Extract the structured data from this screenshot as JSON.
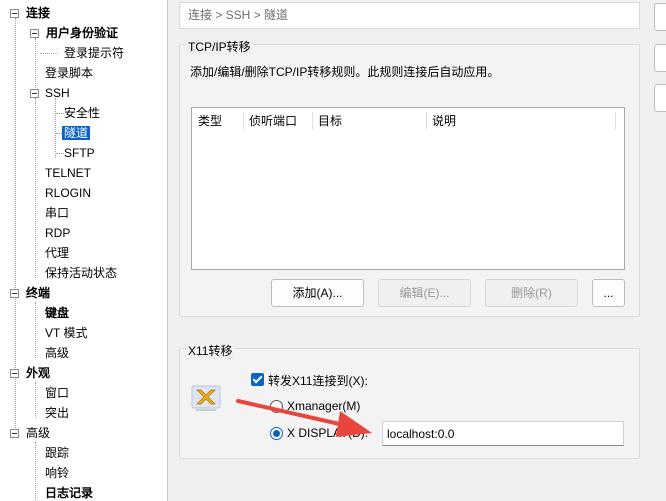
{
  "tree": {
    "connection": "连接",
    "user_auth": "用户身份验证",
    "login_prompt": "登录提示符",
    "login_script": "登录脚本",
    "ssh": "SSH",
    "security": "安全性",
    "tunnel": "隧道",
    "sftp": "SFTP",
    "telnet": "TELNET",
    "rlogin": "RLOGIN",
    "serial": "串口",
    "rdp": "RDP",
    "proxy": "代理",
    "keepalive": "保持活动状态",
    "terminal": "终端",
    "keyboard": "键盘",
    "vt_mode": "VT 模式",
    "terminal_advanced": "高级",
    "appearance": "外观",
    "window": "窗口",
    "highlight": "突出",
    "advanced": "高级",
    "trace": "跟踪",
    "bell": "响铃",
    "logging": "日志记录"
  },
  "breadcrumb": "连接 > SSH > 隧道",
  "tcp": {
    "group_label": "TCP/IP转移",
    "description": "添加/编辑/删除TCP/IP转移规则。此规则连接后自动应用。",
    "columns": [
      "类型",
      "侦听端口",
      "目标",
      "说明"
    ],
    "add_button": "添加(A)...",
    "edit_button": "编辑(E)...",
    "delete_button": "删除(R)",
    "more_button": "..."
  },
  "x11": {
    "group_label": "X11转移",
    "forward_label": "转发X11连接到(X):",
    "forward_checked": true,
    "xmanager_label": "Xmanager(M)",
    "display_label": "X DISPLAY(D):",
    "selected_option": "X DISPLAY(D):",
    "display_value": "localhost:0.0"
  },
  "colors": {
    "accent": "#0a63c9",
    "arrow": "#e8463c"
  },
  "icons": {
    "x11": "x11-x-icon"
  }
}
